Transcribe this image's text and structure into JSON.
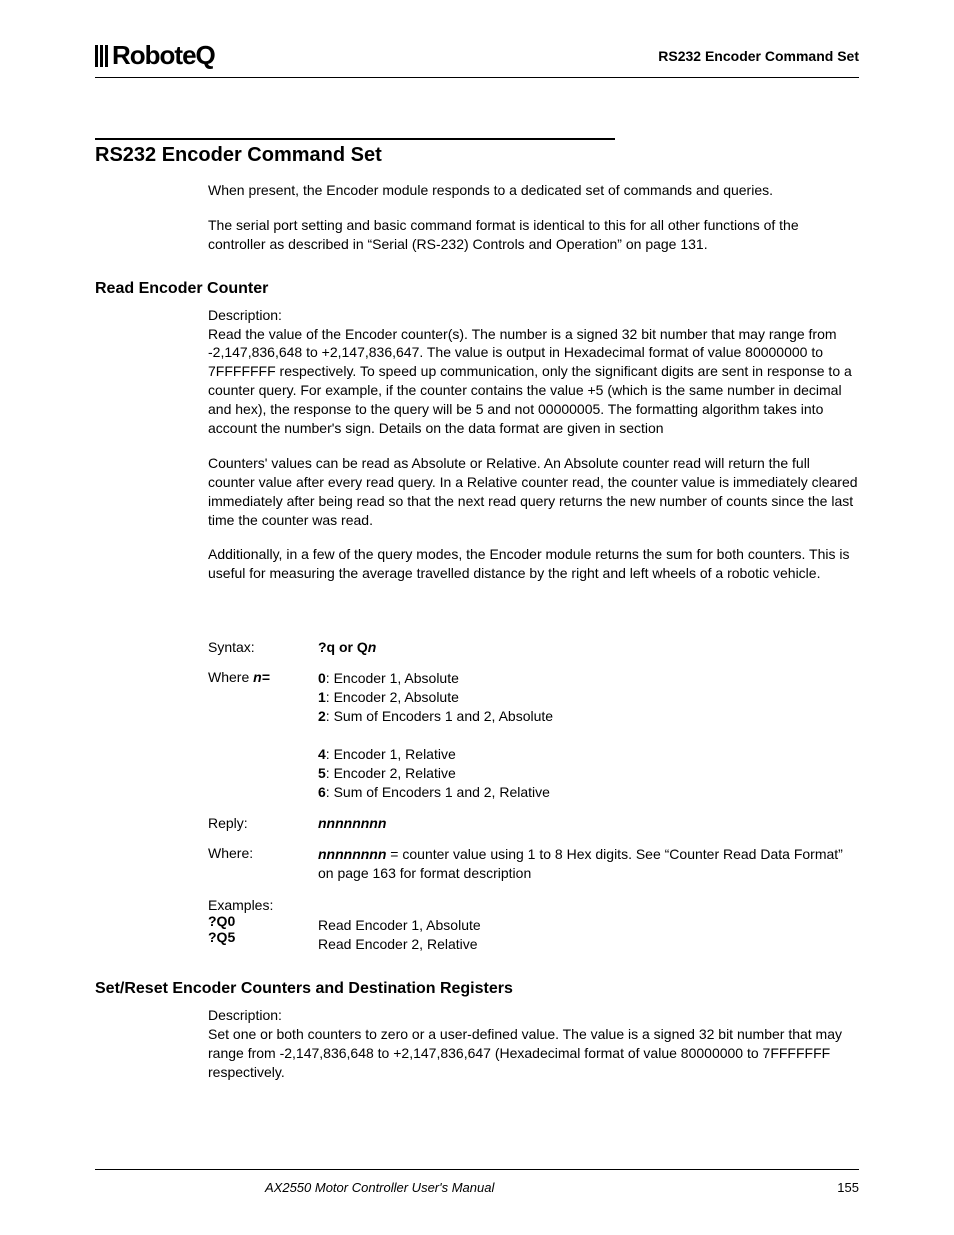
{
  "header": {
    "logo_text": "RoboteQ",
    "title": "RS232 Encoder Command Set"
  },
  "section1": {
    "heading": "RS232 Encoder Command Set",
    "p1": "When present, the Encoder module responds to a dedicated set of commands and queries.",
    "p2": "The serial port setting and basic command format is identical to this for all other functions of the controller as described in “Serial (RS-232) Controls and Operation” on page 131."
  },
  "section2": {
    "heading": "Read Encoder Counter",
    "desc_label": "Description:",
    "p1": "Read the value of the Encoder counter(s). The number is a signed 32 bit number that may range from -2,147,836,648 to +2,147,836,647. The value is output in Hexadecimal format of value 80000000 to 7FFFFFFF respectively. To speed up communication, only the significant digits are sent in response to a counter query. For example, if the counter contains the value +5 (which is the same number in decimal and hex), the response to the query will be 5 and not 00000005. The formatting algorithm takes into account the number's sign. Details on the data format are given in section",
    "p2": "Counters' values can be read as Absolute or Relative. An Absolute counter read will return the full counter value after every read query. In a Relative counter read, the counter value is immediately cleared immediately after being read so that the next read query returns the new number of counts since the last time the counter was read.",
    "p3": "Additionally, in a few of the query modes, the Encoder module returns the sum for both counters. This is useful for measuring the average travelled distance by the right and left wheels of a robotic vehicle.",
    "syntax_label": "Syntax:",
    "syntax_value": "?q or Q",
    "syntax_n": "n",
    "where_n_label": "Where ",
    "where_n_var": "n=",
    "where_values": [
      {
        "k": "0",
        "v": ": Encoder 1, Absolute"
      },
      {
        "k": "1",
        "v": ": Encoder 2, Absolute"
      },
      {
        "k": "2",
        "v": ": Sum of Encoders 1 and 2, Absolute"
      },
      {
        "k": "",
        "v": ""
      },
      {
        "k": "4",
        "v": ": Encoder 1, Relative"
      },
      {
        "k": "5",
        "v": ": Encoder 2, Relative"
      },
      {
        "k": "6",
        "v": ": Sum of Encoders 1 and 2, Relative"
      }
    ],
    "reply_label": "Reply:",
    "reply_value": "nnnnnnnn",
    "where2_label": "Where:",
    "where2_var": "nnnnnnnn",
    "where2_text": " = counter value using 1 to 8 Hex digits. See “Counter Read Data Format” on page 163 for format description",
    "examples_label": "Examples:",
    "ex1_cmd": "?Q0",
    "ex1_desc": "Read Encoder 1, Absolute",
    "ex2_cmd": "?Q5",
    "ex2_desc": "Read Encoder 2, Relative"
  },
  "section3": {
    "heading": "Set/Reset Encoder Counters and Destination Registers",
    "desc_label": "Description:",
    "p1": "Set one or both counters to zero or a user-defined value. The value is a signed 32 bit number that may range from -2,147,836,648 to +2,147,836,647 (Hexadecimal format of value 80000000 to 7FFFFFFF respectively."
  },
  "footer": {
    "manual": "AX2550 Motor Controller User's Manual",
    "page": "155"
  }
}
